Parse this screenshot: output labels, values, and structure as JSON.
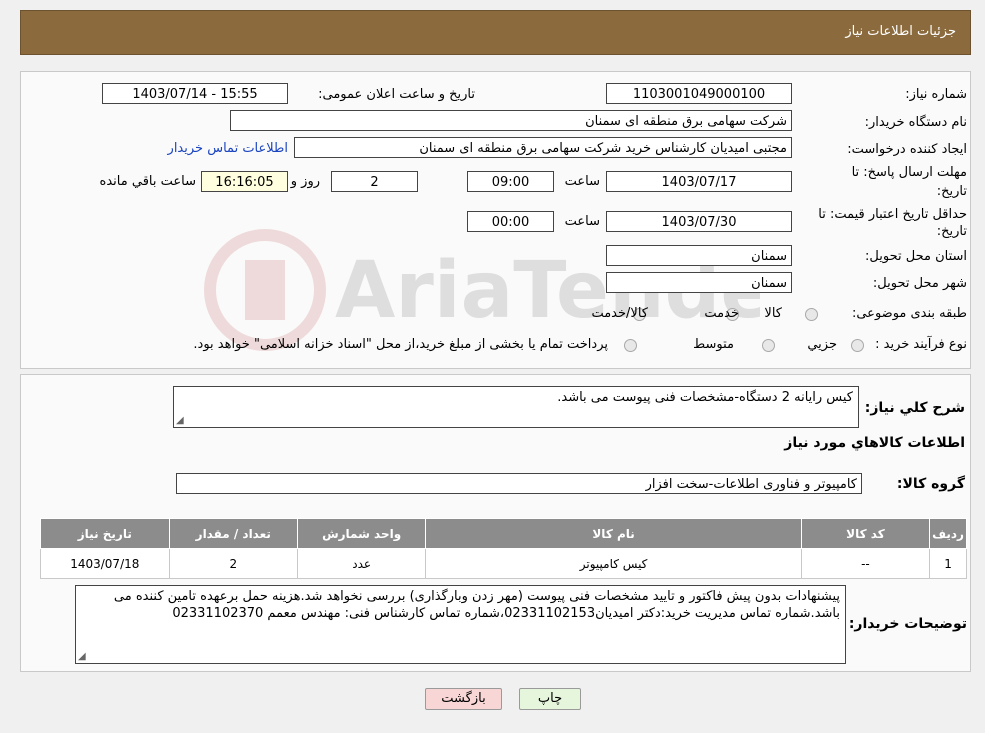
{
  "header": {
    "title": "جزئیات اطلاعات نیاز"
  },
  "details": {
    "need_number_label": "شماره نیاز:",
    "need_number": "1103001049000100",
    "announce_label": "تاریخ و ساعت اعلان عمومی:",
    "announce_value": "1403/07/14 - 15:55",
    "buyer_org_label": "نام دستگاه خریدار:",
    "buyer_org": "شرکت سهامی برق منطقه ای سمنان",
    "creator_label": "ایجاد کننده درخواست:",
    "creator": "مجتبی امیدیان کارشناس خرید شرکت سهامی برق منطقه ای سمنان",
    "contact_link": "اطلاعات تماس خریدار",
    "deadline_label_1": "مهلت ارسال پاسخ: تا",
    "deadline_label_2": "تاریخ:",
    "deadline_date": "1403/07/17",
    "time_label": "ساعت",
    "deadline_time": "09:00",
    "days_value": "2",
    "days_label": "روز و",
    "remaining_time": "16:16:05",
    "remaining_label": "ساعت باقي مانده",
    "validity_label_1": "حداقل تاریخ اعتبار قیمت: تا",
    "validity_label_2": "تاریخ:",
    "validity_date": "1403/07/30",
    "validity_time": "00:00",
    "province_label": "استان محل تحویل:",
    "province": "سمنان",
    "city_label": "شهر محل تحویل:",
    "city": "سمنان",
    "category_label": "طبقه بندی موضوعی:",
    "category_options": [
      "کالا",
      "خدمت",
      "کالا/خدمت"
    ],
    "process_label": "نوع فرآیند خرید :",
    "process_options": [
      "جزيي",
      "متوسط"
    ],
    "process_note": "پرداخت تمام یا بخشی از مبلغ خرید،از محل \"اسناد خزانه اسلامی\" خواهد بود."
  },
  "summary": {
    "description_label": "شرح کلي نياز:",
    "description": "کیس رایانه 2 دستگاه-مشخصات فنی پیوست می باشد.",
    "goods_info_title": "اطلاعات کالاهاي مورد نياز",
    "goods_group_label": "گروه کالا:",
    "goods_group": "کامپیوتر و فناوری اطلاعات-سخت افزار"
  },
  "table": {
    "headers": [
      "ردیف",
      "کد کالا",
      "نام کالا",
      "واحد شمارش",
      "تعداد / مقدار",
      "تاریخ نیاز"
    ],
    "rows": [
      [
        "1",
        "--",
        "کیس کامپیوتر",
        "عدد",
        "2",
        "1403/07/18"
      ]
    ]
  },
  "buyer_notes": {
    "label": "توضیحات خریدار:",
    "text": "پیشنهادات بدون پیش فاکتور و تایید مشخصات فنی پیوست (مهر زدن وبارگذاری) بررسی نخواهد شد.هزینه حمل برعهده تامین کننده می باشد.شماره تماس مدیریت خرید:دکتر امیدیان02331102153،شماره تماس کارشناس فنی: مهندس معمم 02331102370"
  },
  "buttons": {
    "print": "چاپ",
    "back": "بازگشت"
  },
  "colors": {
    "header": "#8b6a3e",
    "link": "#1a44c0",
    "back_button": "#f9d6d6",
    "print_button": "#e6f6dc"
  }
}
